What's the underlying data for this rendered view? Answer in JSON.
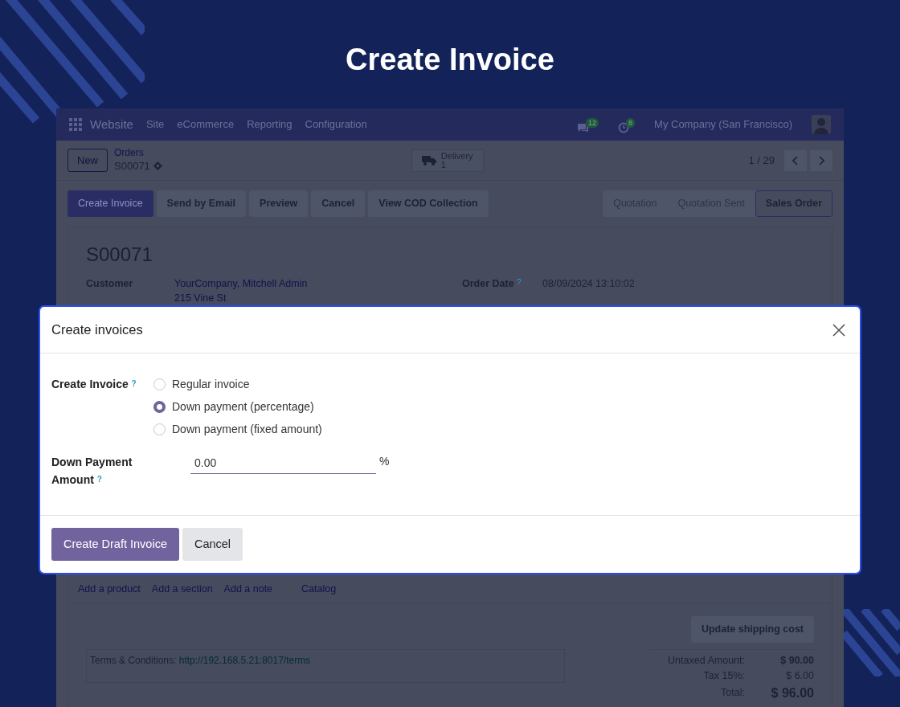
{
  "page_title": "Create Invoice",
  "app": {
    "navbar": {
      "app_name": "Website",
      "menu": [
        "Site",
        "eCommerce",
        "Reporting",
        "Configuration"
      ],
      "messages_count": "12",
      "activities_count": "8",
      "company": "My Company (San Francisco)"
    },
    "control_panel": {
      "new_button": "New",
      "breadcrumb": "Orders",
      "record": "S00071",
      "smart_button": {
        "label": "Delivery",
        "count": "1"
      },
      "pager": "1 / 29"
    },
    "actions": [
      {
        "label": "Create Invoice",
        "primary": true
      },
      {
        "label": "Send by Email",
        "primary": false
      },
      {
        "label": "Preview",
        "primary": false
      },
      {
        "label": "Cancel",
        "primary": false
      },
      {
        "label": "View COD Collection",
        "primary": false
      }
    ],
    "statusbar": [
      {
        "label": "Quotation",
        "selected": false
      },
      {
        "label": "Quotation Sent",
        "selected": false
      },
      {
        "label": "Sales Order",
        "selected": true
      }
    ],
    "form": {
      "title": "S00071",
      "customer_label": "Customer",
      "customer_lines": [
        "YourCompany, Mitchell Admin",
        "215 Vine St"
      ],
      "order_date_label": "Order Date",
      "order_date_help": "?",
      "order_date": "08/09/2024 13:10:02"
    },
    "line_actions": [
      "Add a product",
      "Add a section",
      "Add a note",
      "Catalog"
    ],
    "update_shipping": "Update shipping cost",
    "terms": {
      "label": "Terms & Conditions:",
      "link": "http://192.168.5.21:8017/terms"
    },
    "totals": [
      {
        "label": "Untaxed Amount:",
        "value": "$ 90.00",
        "kind": "bold"
      },
      {
        "label": "Tax 15%:",
        "value": "$ 6.00",
        "kind": "plain"
      },
      {
        "label": "Total:",
        "value": "$ 96.00",
        "kind": "grand"
      }
    ]
  },
  "dialog": {
    "title": "Create invoices",
    "field_label": "Create Invoice",
    "field_help": "?",
    "options": [
      {
        "label": "Regular invoice",
        "selected": false
      },
      {
        "label": "Down payment (percentage)",
        "selected": true
      },
      {
        "label": "Down payment (fixed amount)",
        "selected": false
      }
    ],
    "amount_label": "Down Payment Amount",
    "amount_help": "?",
    "amount_value": "0.00",
    "amount_unit": "%",
    "buttons": [
      {
        "label": "Create Draft Invoice",
        "kind": "primary"
      },
      {
        "label": "Cancel",
        "kind": "secondary"
      }
    ]
  }
}
